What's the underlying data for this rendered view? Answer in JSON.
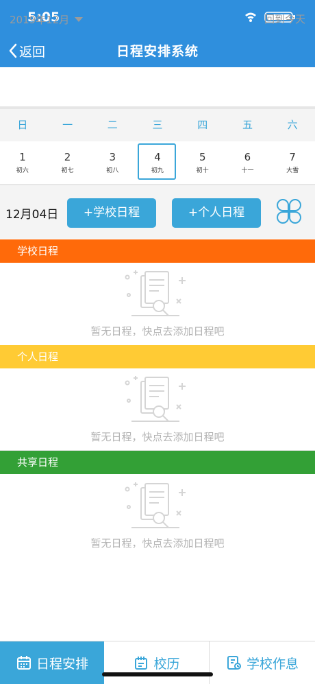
{
  "status": {
    "time": "5:05"
  },
  "nav": {
    "back_label": "返回",
    "title": "日程安排系统"
  },
  "month": {
    "label": "2019年12月",
    "today_label": "回到今天"
  },
  "week": {
    "headers": [
      "日",
      "一",
      "二",
      "三",
      "四",
      "五",
      "六"
    ]
  },
  "days": [
    {
      "num": "1",
      "lunar": "初六"
    },
    {
      "num": "2",
      "lunar": "初七"
    },
    {
      "num": "3",
      "lunar": "初八"
    },
    {
      "num": "4",
      "lunar": "初九"
    },
    {
      "num": "5",
      "lunar": "初十"
    },
    {
      "num": "6",
      "lunar": "十一"
    },
    {
      "num": "7",
      "lunar": "大雪"
    }
  ],
  "selected_day_index": 3,
  "actions": {
    "date_label": "12月04日",
    "add_school": "+学校日程",
    "add_personal": "+个人日程"
  },
  "sections": [
    {
      "title": "学校日程",
      "color": "#ff6a0a",
      "empty_text": "暂无日程，快点去添加日程吧"
    },
    {
      "title": "个人日程",
      "color": "#ffcb34",
      "empty_text": "暂无日程，快点去添加日程吧"
    },
    {
      "title": "共享日程",
      "color": "#33a036",
      "empty_text": "暂无日程，快点去添加日程吧"
    }
  ],
  "tabs": [
    {
      "label": "日程安排",
      "icon": "calendar-icon",
      "active": true
    },
    {
      "label": "校历",
      "icon": "school-calendar-icon",
      "active": false
    },
    {
      "label": "学校作息",
      "icon": "timetable-icon",
      "active": false
    }
  ],
  "colors": {
    "primary": "#2f8fdd",
    "accent": "#3aa6d9"
  }
}
